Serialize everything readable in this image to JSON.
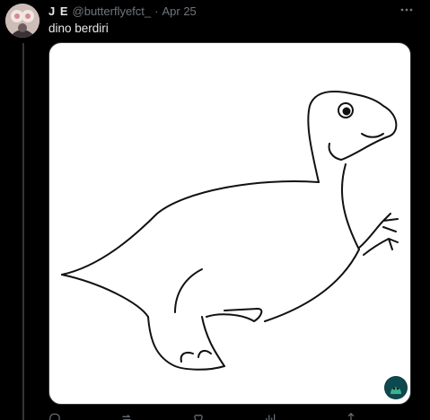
{
  "post": {
    "display_name": "J E",
    "handle": "@butterflyefct_",
    "separator": "·",
    "date": "Apr 25",
    "text": "dino berdiri",
    "media_alt": "line drawing of a long-necked dinosaur"
  },
  "icons": {
    "more": "more-icon",
    "reply": "reply-icon",
    "repost": "repost-icon",
    "like": "like-icon",
    "views": "views-icon",
    "share": "share-icon",
    "watermark": "watermark-badge"
  },
  "colors": {
    "background": "#000000",
    "text_primary": "#e7e9ea",
    "text_secondary": "#71767b",
    "media_bg": "#ffffff",
    "border": "#2f3336"
  }
}
